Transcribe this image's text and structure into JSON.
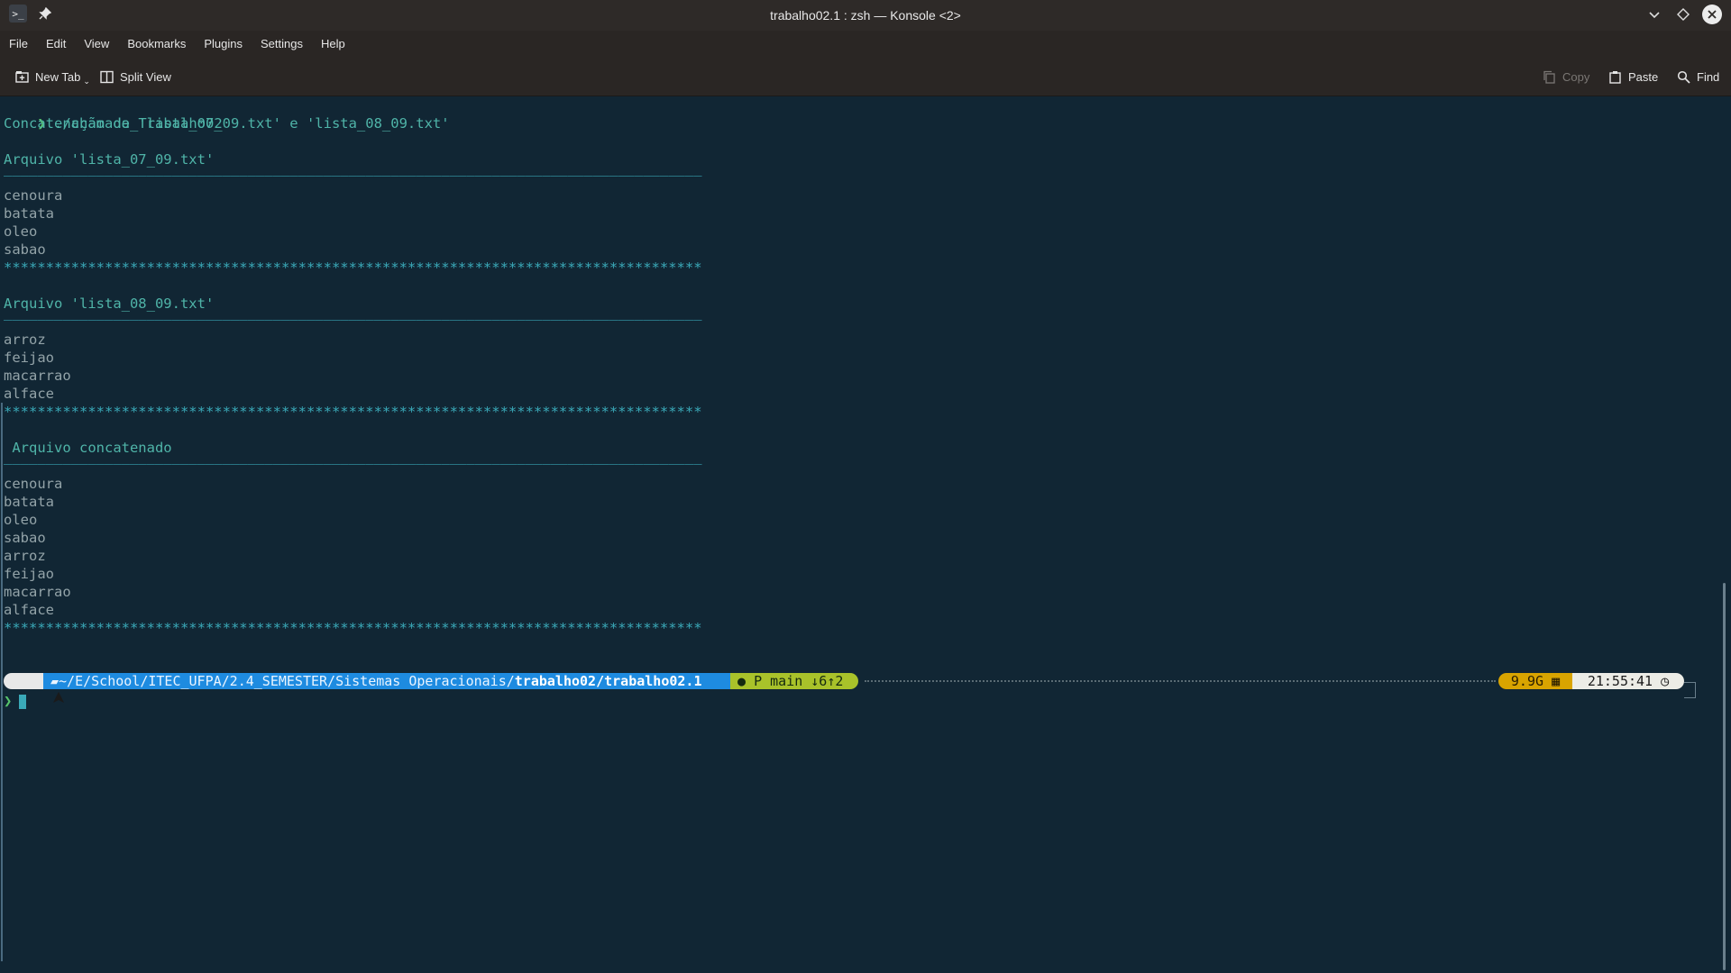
{
  "window": {
    "title": "trabalho02.1 : zsh — Konsole <2>",
    "icons": [
      "terminal-icon",
      "pin-icon",
      "minimize-chevron-icon",
      "maximize-diamond-icon",
      "close-icon"
    ]
  },
  "menu": {
    "items": [
      "File",
      "Edit",
      "View",
      "Bookmarks",
      "Plugins",
      "Settings",
      "Help"
    ]
  },
  "toolbar": {
    "new_tab": "New Tab",
    "split_view": "Split View",
    "copy": "Copy",
    "paste": "Paste",
    "find": "Find"
  },
  "terminal": {
    "prompt_symbol": "❯",
    "command": "./chamada_Trabalho02",
    "lines": [
      "Concatenação de 'lista_07_09.txt' e 'lista_08_09.txt'",
      "",
      "Arquivo 'lista_07_09.txt'",
      "___________________________________________________________________________________",
      "cenoura",
      "batata",
      "oleo",
      "sabao",
      "***********************************************************************************",
      "",
      "Arquivo 'lista_08_09.txt'",
      "___________________________________________________________________________________",
      "arroz",
      "feijao",
      "macarrao",
      "alface",
      "***********************************************************************************",
      "",
      " Arquivo concatenado",
      "___________________________________________________________________________________",
      "cenoura",
      "batata",
      "oleo",
      "sabao",
      "arroz",
      "feijao",
      "macarrao",
      "alface",
      "***********************************************************************************"
    ],
    "statusline": {
      "os_icon": "arch-icon",
      "path_prefix": "~/E/School/ITEC_UFPA/2.4_SEMESTER/Sistemas Operacionais/",
      "path_bold": "trabalho02/trabalho02.1",
      "git": "P main ↓6↑2",
      "memory": "9.9G",
      "time": "21:55:41"
    }
  }
}
